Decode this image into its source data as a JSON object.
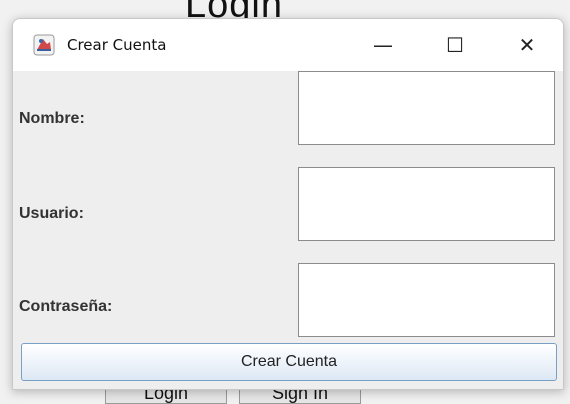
{
  "window": {
    "title": "Crear Cuenta",
    "controls": {
      "minimize": "—",
      "maximize": "☐",
      "close": "✕"
    }
  },
  "form": {
    "nombre_label": "Nombre:",
    "usuario_label": "Usuario:",
    "contrasena_label": "Contraseña:",
    "submit_label": "Crear Cuenta"
  },
  "background": {
    "fragment_title": "Login",
    "button1": "Login",
    "button2": "Sign In"
  }
}
